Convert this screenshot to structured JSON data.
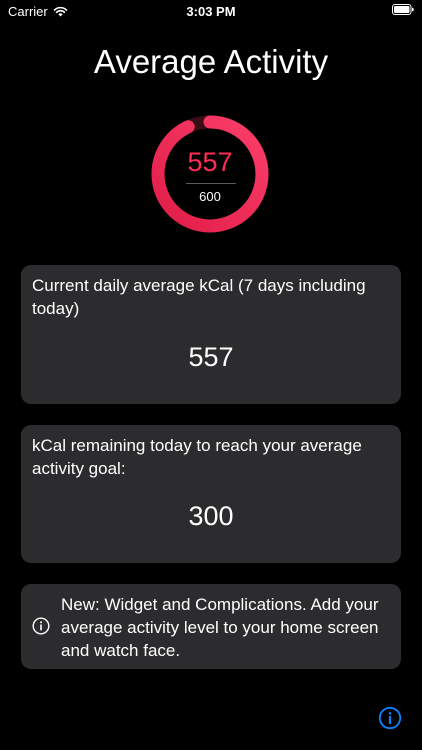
{
  "status_bar": {
    "carrier": "Carrier",
    "time": "3:03 PM"
  },
  "title": "Average Activity",
  "ring": {
    "value": "557",
    "goal": "600",
    "progress_fraction": 0.93,
    "color_start": "#e11d48",
    "color_end": "#fb3e6a"
  },
  "cards": {
    "average": {
      "label": "Current daily average kCal (7 days including today)",
      "value": "557"
    },
    "remaining": {
      "label": "kCal remaining today to reach your average activity goal:",
      "value": "300"
    },
    "announcement": {
      "text": "New: Widget and Complications. Add your average activity level to your home screen and watch face."
    }
  },
  "icons": {
    "note_icon": "info-circle-icon",
    "info_button_icon": "info-circle-icon"
  },
  "colors": {
    "background": "#000000",
    "card": "#2c2c2e",
    "ring_value": "#ff2d55",
    "accent": "#0a84ff"
  }
}
